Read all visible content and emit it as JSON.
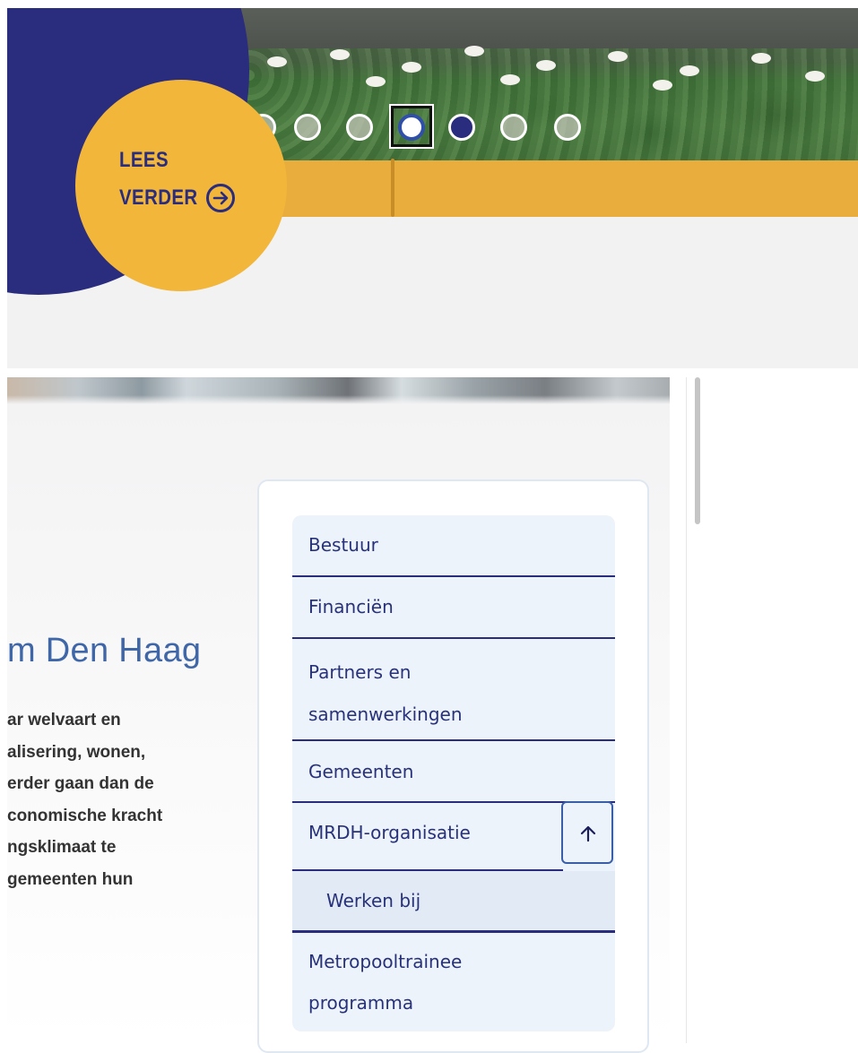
{
  "hero": {
    "cta": {
      "line1": "LEES",
      "line2": "VERDER",
      "icon": "arrow-right-circle-icon"
    },
    "carousel": {
      "slide_count": 7,
      "active_index": 4,
      "focused_index": 3
    }
  },
  "content": {
    "heading": "m Den Haag",
    "body_lines": [
      "ar welvaart en",
      "alisering, wonen,",
      "erder gaan dan de",
      "conomische kracht",
      "ngsklimaat te",
      "gemeenten hun"
    ]
  },
  "sidenav": {
    "items": [
      {
        "label": "Bestuur"
      },
      {
        "label": "Financiën"
      },
      {
        "label": "Partners en samenwerkingen"
      },
      {
        "label": "Gemeenten"
      },
      {
        "label": "MRDH-organisatie"
      },
      {
        "label": "Werken bij"
      },
      {
        "label": "Metropooltrainee programma"
      }
    ],
    "partners_lines": [
      "Partners en",
      "samenwerkingen"
    ],
    "metro_lines": [
      "Metropooltrainee",
      "programma"
    ],
    "toggle_icon": "arrow-up-icon"
  },
  "colors": {
    "navy": "#2a2c7d",
    "yellow": "#f2b63a",
    "heading_blue": "#3f66a6",
    "nav_bg": "#edf3fa"
  }
}
